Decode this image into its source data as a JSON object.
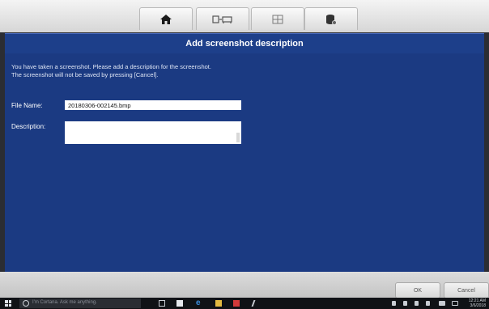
{
  "toolbar": {
    "buttons": [
      {
        "name": "home-icon"
      },
      {
        "name": "print-vehicle-icon"
      },
      {
        "name": "grid-icon"
      },
      {
        "name": "data-manager-icon"
      }
    ]
  },
  "dialog": {
    "title": "Add screenshot description",
    "intro_line1": "You have taken a screenshot. Please add a description for the screenshot.",
    "intro_line2": "The screenshot will not be saved by pressing [Cancel].",
    "file_name_label": "File Name:",
    "file_name_value": "20180306-002145.bmp",
    "description_label": "Description:",
    "description_value": ""
  },
  "actions": {
    "ok_label": "OK",
    "cancel_label": "Cancel"
  },
  "taskbar": {
    "search_placeholder": "I'm Cortana. Ask me anything.",
    "time": "12:21 AM",
    "date": "3/6/2018"
  },
  "colors": {
    "dialog_bg": "#1b3a82",
    "title_bar": "#1d3f8a",
    "toolbar_bg": "#e6e6e6"
  }
}
